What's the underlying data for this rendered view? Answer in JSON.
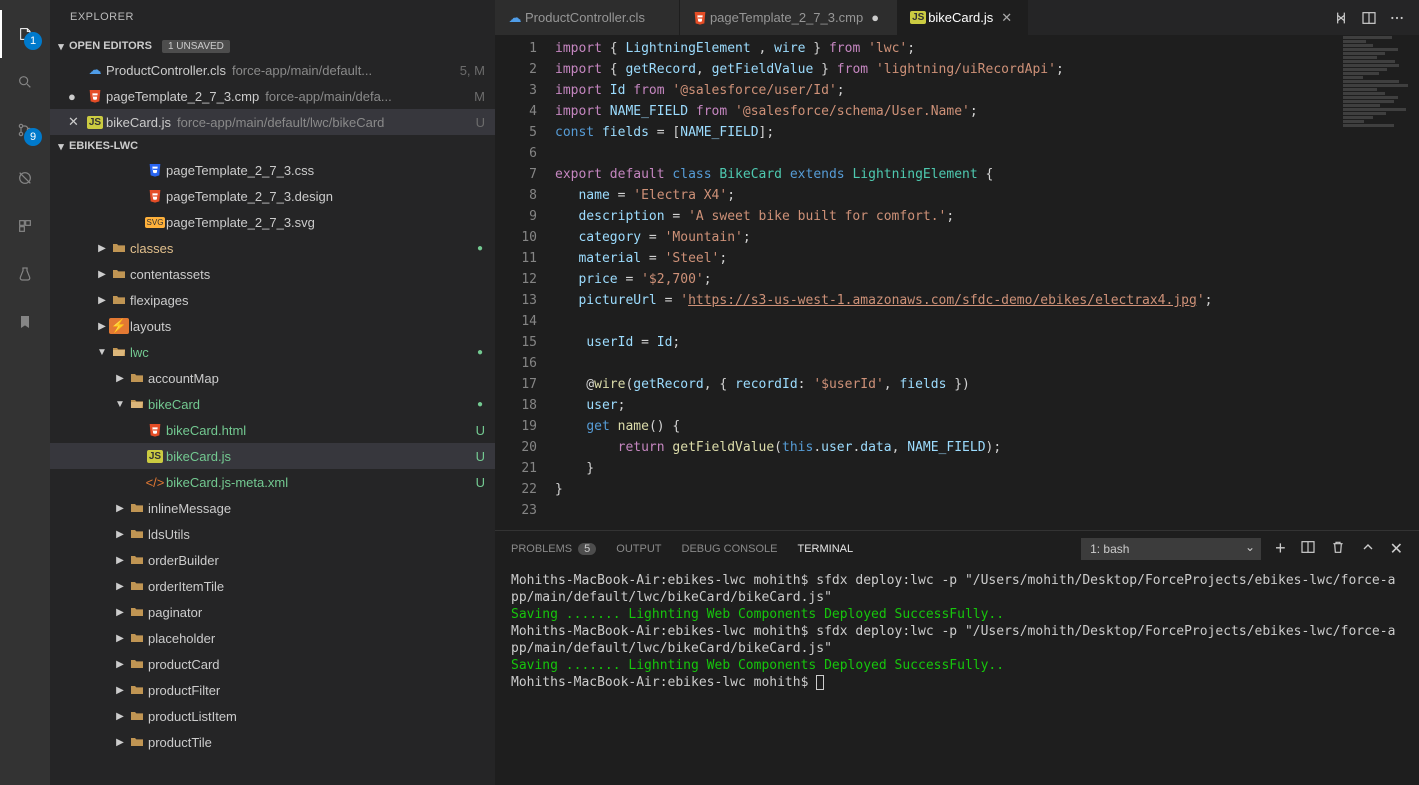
{
  "sidebar": {
    "title": "EXPLORER",
    "open_editors_label": "OPEN EDITORS",
    "unsaved_tag": "1 UNSAVED",
    "open_editors": [
      {
        "icon": "apex",
        "name": "ProductController.cls",
        "path": "force-app/main/default...",
        "status": "5, M",
        "status_cls": "status-5m",
        "dirty": false
      },
      {
        "icon": "html5",
        "name": "pageTemplate_2_7_3.cmp",
        "path": "force-app/main/defa...",
        "status": "M",
        "status_cls": "status-m",
        "dirty": true
      },
      {
        "icon": "js",
        "name": "bikeCard.js",
        "path": "force-app/main/default/lwc/bikeCard",
        "status": "U",
        "status_cls": "status-u",
        "dirty": false,
        "active": true
      }
    ],
    "project_label": "EBIKES-LWC",
    "tree": [
      {
        "indent": 4,
        "kind": "file",
        "icon": "css",
        "label": "pageTemplate_2_7_3.css"
      },
      {
        "indent": 4,
        "kind": "file",
        "icon": "html5",
        "label": "pageTemplate_2_7_3.design"
      },
      {
        "indent": 4,
        "kind": "file",
        "icon": "svg",
        "label": "pageTemplate_2_7_3.svg"
      },
      {
        "indent": 2,
        "kind": "folder",
        "arrow": "▶",
        "label": "classes",
        "label_cls": "git-m",
        "dot": true
      },
      {
        "indent": 2,
        "kind": "folder",
        "arrow": "▶",
        "label": "contentassets"
      },
      {
        "indent": 2,
        "kind": "folder",
        "arrow": "▶",
        "label": "flexipages"
      },
      {
        "indent": 2,
        "kind": "folder",
        "arrow": "▶",
        "label": "layouts",
        "folder_icon": "lightning"
      },
      {
        "indent": 2,
        "kind": "folder-open",
        "arrow": "▼",
        "label": "lwc",
        "label_cls": "git-u",
        "dot": true
      },
      {
        "indent": 3,
        "kind": "folder",
        "arrow": "▶",
        "label": "accountMap"
      },
      {
        "indent": 3,
        "kind": "folder-open",
        "arrow": "▼",
        "label": "bikeCard",
        "label_cls": "git-u",
        "dot": true
      },
      {
        "indent": 4,
        "kind": "file",
        "icon": "html5",
        "label": "bikeCard.html",
        "label_cls": "git-u",
        "status": "U",
        "status_cls": "status-u"
      },
      {
        "indent": 4,
        "kind": "file",
        "icon": "js",
        "label": "bikeCard.js",
        "label_cls": "git-u",
        "status": "U",
        "status_cls": "status-u",
        "selected": true
      },
      {
        "indent": 4,
        "kind": "file",
        "icon": "xml",
        "label": "bikeCard.js-meta.xml",
        "label_cls": "git-u",
        "status": "U",
        "status_cls": "status-u"
      },
      {
        "indent": 3,
        "kind": "folder",
        "arrow": "▶",
        "label": "inlineMessage"
      },
      {
        "indent": 3,
        "kind": "folder",
        "arrow": "▶",
        "label": "ldsUtils"
      },
      {
        "indent": 3,
        "kind": "folder",
        "arrow": "▶",
        "label": "orderBuilder"
      },
      {
        "indent": 3,
        "kind": "folder",
        "arrow": "▶",
        "label": "orderItemTile"
      },
      {
        "indent": 3,
        "kind": "folder",
        "arrow": "▶",
        "label": "paginator"
      },
      {
        "indent": 3,
        "kind": "folder",
        "arrow": "▶",
        "label": "placeholder"
      },
      {
        "indent": 3,
        "kind": "folder",
        "arrow": "▶",
        "label": "productCard"
      },
      {
        "indent": 3,
        "kind": "folder",
        "arrow": "▶",
        "label": "productFilter"
      },
      {
        "indent": 3,
        "kind": "folder",
        "arrow": "▶",
        "label": "productListItem"
      },
      {
        "indent": 3,
        "kind": "folder",
        "arrow": "▶",
        "label": "productTile"
      }
    ]
  },
  "activity": {
    "explorer_badge": "1",
    "scm_badge": "9"
  },
  "tabs": [
    {
      "icon": "apex",
      "label": "ProductController.cls"
    },
    {
      "icon": "html5",
      "label": "pageTemplate_2_7_3.cmp",
      "dirty": true
    },
    {
      "icon": "js",
      "label": "bikeCard.js",
      "active": true,
      "close": true
    }
  ],
  "code": {
    "lines": [
      [
        {
          "c": "kw",
          "t": "import"
        },
        {
          "c": "pl",
          "t": " { "
        },
        {
          "c": "id",
          "t": "LightningElement"
        },
        {
          "c": "pl",
          "t": " , "
        },
        {
          "c": "id",
          "t": "wire"
        },
        {
          "c": "pl",
          "t": " } "
        },
        {
          "c": "kw",
          "t": "from"
        },
        {
          "c": "pl",
          "t": " "
        },
        {
          "c": "str",
          "t": "'lwc'"
        },
        {
          "c": "pl",
          "t": ";"
        }
      ],
      [
        {
          "c": "kw",
          "t": "import"
        },
        {
          "c": "pl",
          "t": " { "
        },
        {
          "c": "id",
          "t": "getRecord"
        },
        {
          "c": "pl",
          "t": ", "
        },
        {
          "c": "id",
          "t": "getFieldValue"
        },
        {
          "c": "pl",
          "t": " } "
        },
        {
          "c": "kw",
          "t": "from"
        },
        {
          "c": "pl",
          "t": " "
        },
        {
          "c": "str",
          "t": "'lightning/uiRecordApi'"
        },
        {
          "c": "pl",
          "t": ";"
        }
      ],
      [
        {
          "c": "kw",
          "t": "import"
        },
        {
          "c": "pl",
          "t": " "
        },
        {
          "c": "id",
          "t": "Id"
        },
        {
          "c": "pl",
          "t": " "
        },
        {
          "c": "kw",
          "t": "from"
        },
        {
          "c": "pl",
          "t": " "
        },
        {
          "c": "str",
          "t": "'@salesforce/user/Id'"
        },
        {
          "c": "pl",
          "t": ";"
        }
      ],
      [
        {
          "c": "kw",
          "t": "import"
        },
        {
          "c": "pl",
          "t": " "
        },
        {
          "c": "id",
          "t": "NAME_FIELD"
        },
        {
          "c": "pl",
          "t": " "
        },
        {
          "c": "kw",
          "t": "from"
        },
        {
          "c": "pl",
          "t": " "
        },
        {
          "c": "str",
          "t": "'@salesforce/schema/User.Name'"
        },
        {
          "c": "pl",
          "t": ";"
        }
      ],
      [
        {
          "c": "kw2",
          "t": "const"
        },
        {
          "c": "pl",
          "t": " "
        },
        {
          "c": "id",
          "t": "fields"
        },
        {
          "c": "pl",
          "t": " = ["
        },
        {
          "c": "id",
          "t": "NAME_FIELD"
        },
        {
          "c": "pl",
          "t": "];"
        }
      ],
      [],
      [
        {
          "c": "kw",
          "t": "export"
        },
        {
          "c": "pl",
          "t": " "
        },
        {
          "c": "kw",
          "t": "default"
        },
        {
          "c": "pl",
          "t": " "
        },
        {
          "c": "kw2",
          "t": "class"
        },
        {
          "c": "pl",
          "t": " "
        },
        {
          "c": "cls",
          "t": "BikeCard"
        },
        {
          "c": "pl",
          "t": " "
        },
        {
          "c": "kw2",
          "t": "extends"
        },
        {
          "c": "pl",
          "t": " "
        },
        {
          "c": "cls",
          "t": "LightningElement"
        },
        {
          "c": "pl",
          "t": " {"
        }
      ],
      [
        {
          "c": "pl",
          "t": "   "
        },
        {
          "c": "id",
          "t": "name"
        },
        {
          "c": "pl",
          "t": " = "
        },
        {
          "c": "str",
          "t": "'Electra X4'"
        },
        {
          "c": "pl",
          "t": ";"
        }
      ],
      [
        {
          "c": "pl",
          "t": "   "
        },
        {
          "c": "id",
          "t": "description"
        },
        {
          "c": "pl",
          "t": " = "
        },
        {
          "c": "str",
          "t": "'A sweet bike built for comfort.'"
        },
        {
          "c": "pl",
          "t": ";"
        }
      ],
      [
        {
          "c": "pl",
          "t": "   "
        },
        {
          "c": "id",
          "t": "category"
        },
        {
          "c": "pl",
          "t": " = "
        },
        {
          "c": "str",
          "t": "'Mountain'"
        },
        {
          "c": "pl",
          "t": ";"
        }
      ],
      [
        {
          "c": "pl",
          "t": "   "
        },
        {
          "c": "id",
          "t": "material"
        },
        {
          "c": "pl",
          "t": " = "
        },
        {
          "c": "str",
          "t": "'Steel'"
        },
        {
          "c": "pl",
          "t": ";"
        }
      ],
      [
        {
          "c": "pl",
          "t": "   "
        },
        {
          "c": "id",
          "t": "price"
        },
        {
          "c": "pl",
          "t": " = "
        },
        {
          "c": "str",
          "t": "'$2,700'"
        },
        {
          "c": "pl",
          "t": ";"
        }
      ],
      [
        {
          "c": "pl",
          "t": "   "
        },
        {
          "c": "id",
          "t": "pictureUrl"
        },
        {
          "c": "pl",
          "t": " = "
        },
        {
          "c": "str",
          "t": "'"
        },
        {
          "c": "url",
          "t": "https://s3-us-west-1.amazonaws.com/sfdc-demo/ebikes/electrax4.jpg"
        },
        {
          "c": "str",
          "t": "'"
        },
        {
          "c": "pl",
          "t": ";"
        }
      ],
      [],
      [
        {
          "c": "pl",
          "t": "    "
        },
        {
          "c": "id",
          "t": "userId"
        },
        {
          "c": "pl",
          "t": " = "
        },
        {
          "c": "id",
          "t": "Id"
        },
        {
          "c": "pl",
          "t": ";"
        }
      ],
      [],
      [
        {
          "c": "pl",
          "t": "    @"
        },
        {
          "c": "fn",
          "t": "wire"
        },
        {
          "c": "pl",
          "t": "("
        },
        {
          "c": "id",
          "t": "getRecord"
        },
        {
          "c": "pl",
          "t": ", { "
        },
        {
          "c": "id",
          "t": "recordId"
        },
        {
          "c": "pl",
          "t": ": "
        },
        {
          "c": "str",
          "t": "'$userId'"
        },
        {
          "c": "pl",
          "t": ", "
        },
        {
          "c": "id",
          "t": "fields"
        },
        {
          "c": "pl",
          "t": " })"
        }
      ],
      [
        {
          "c": "pl",
          "t": "    "
        },
        {
          "c": "id",
          "t": "user"
        },
        {
          "c": "pl",
          "t": ";"
        }
      ],
      [
        {
          "c": "pl",
          "t": "    "
        },
        {
          "c": "kw2",
          "t": "get"
        },
        {
          "c": "pl",
          "t": " "
        },
        {
          "c": "fn",
          "t": "name"
        },
        {
          "c": "pl",
          "t": "() {"
        }
      ],
      [
        {
          "c": "pl",
          "t": "        "
        },
        {
          "c": "kw",
          "t": "return"
        },
        {
          "c": "pl",
          "t": " "
        },
        {
          "c": "fn",
          "t": "getFieldValue"
        },
        {
          "c": "pl",
          "t": "("
        },
        {
          "c": "kw2",
          "t": "this"
        },
        {
          "c": "pl",
          "t": "."
        },
        {
          "c": "id",
          "t": "user"
        },
        {
          "c": "pl",
          "t": "."
        },
        {
          "c": "id",
          "t": "data"
        },
        {
          "c": "pl",
          "t": ", "
        },
        {
          "c": "id",
          "t": "NAME_FIELD"
        },
        {
          "c": "pl",
          "t": ");"
        }
      ],
      [
        {
          "c": "pl",
          "t": "    }"
        }
      ],
      [
        {
          "c": "pl",
          "t": "}"
        }
      ],
      []
    ]
  },
  "panel": {
    "tabs": {
      "problems": "PROBLEMS",
      "problems_count": "5",
      "output": "OUTPUT",
      "debug": "DEBUG CONSOLE",
      "terminal": "TERMINAL"
    },
    "select_value": "1: bash",
    "terminal_lines": [
      {
        "type": "plain",
        "text": "Mohiths-MacBook-Air:ebikes-lwc mohith$ sfdx deploy:lwc -p \"/Users/mohith/Desktop/ForceProjects/ebikes-lwc/force-app/main/default/lwc/bikeCard/bikeCard.js\""
      },
      {
        "type": "green",
        "text": "Saving ....... Lighnting Web Components Deployed SuccessFully.."
      },
      {
        "type": "plain",
        "text": "Mohiths-MacBook-Air:ebikes-lwc mohith$ sfdx deploy:lwc -p \"/Users/mohith/Desktop/ForceProjects/ebikes-lwc/force-app/main/default/lwc/bikeCard/bikeCard.js\""
      },
      {
        "type": "green",
        "text": "Saving ....... Lighnting Web Components Deployed SuccessFully.."
      },
      {
        "type": "prompt",
        "text": "Mohiths-MacBook-Air:ebikes-lwc mohith$ "
      }
    ]
  }
}
